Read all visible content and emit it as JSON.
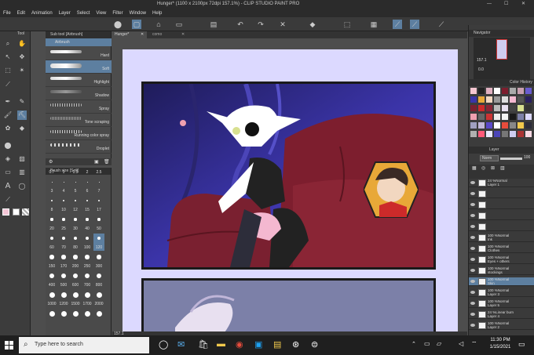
{
  "window_title": "Hunger* (1100 x 2100px 72dpi 157.1%) - CLIP STUDIO PAINT PRO",
  "menu": [
    "File",
    "Edit",
    "Animation",
    "Layer",
    "Select",
    "View",
    "Filter",
    "Window",
    "Help"
  ],
  "tabs": [
    {
      "label": "Hunger*",
      "active": true
    },
    {
      "label": "como",
      "active": false
    }
  ],
  "left_panel": {
    "tool_header": "Tool",
    "subtool_header": "Sub tool [Airbrush]",
    "group_label": "Airbrush"
  },
  "subtools": [
    "Hard",
    "Soft",
    "Highlight",
    "Shadow",
    "Spray",
    "Tone scraping",
    "Running color spray",
    "Droplet"
  ],
  "brush_size": {
    "header": "Brush size [Soft]",
    "rows": [
      [
        "0.7",
        "1",
        "1.5",
        "2",
        "2.5"
      ],
      [
        "3",
        "4",
        "5",
        "6",
        "7"
      ],
      [
        "8",
        "10",
        "12",
        "15",
        "17"
      ],
      [
        "20",
        "25",
        "30",
        "40",
        "50"
      ],
      [
        "60",
        "70",
        "80",
        "100",
        "120"
      ],
      [
        "150",
        "170",
        "200",
        "250",
        "300"
      ],
      [
        "400",
        "500",
        "600",
        "700",
        "800"
      ],
      [
        "1000",
        "1200",
        "1500",
        "1700",
        "2000"
      ]
    ]
  },
  "navigator": {
    "header": "Navigator",
    "zoom": "157.1",
    "rotation": "0.0"
  },
  "color_history": {
    "header": "Color History"
  },
  "layer_panel": {
    "header": "Layer",
    "blend_mode": "Norm",
    "opacity": "100",
    "layers": [
      {
        "line1": "24 %Normal",
        "line2": "Layer 1"
      },
      {
        "line1": "",
        "line2": ""
      },
      {
        "line1": "",
        "line2": ""
      },
      {
        "line1": "",
        "line2": ""
      },
      {
        "line1": "",
        "line2": ""
      },
      {
        "line1": "100 %Normal",
        "line2": "Ink"
      },
      {
        "line1": "100 %Normal",
        "line2": "Clothes"
      },
      {
        "line1": "100 %Normal",
        "line2": "Eyes + others"
      },
      {
        "line1": "100 %Normal",
        "line2": "stockings"
      },
      {
        "line1": "100 %Normal",
        "line2": "Skin"
      },
      {
        "line1": "100 %Normal",
        "line2": "Layer 3"
      },
      {
        "line1": "100 %Normal",
        "line2": "Layer 5"
      },
      {
        "line1": "24 %Linear burn",
        "line2": "Layer 4"
      },
      {
        "line1": "100 %Normal",
        "line2": "Layer 2"
      }
    ]
  },
  "status": {
    "zoom": "157.1"
  },
  "taskbar": {
    "search_placeholder": "Type here to search",
    "time": "11:30 PM",
    "date": "1/15/2021"
  },
  "colors": {
    "page_bg": "#dcd9ff",
    "panel_border": "#1a1a1a",
    "accent": "#5d7fa0"
  }
}
